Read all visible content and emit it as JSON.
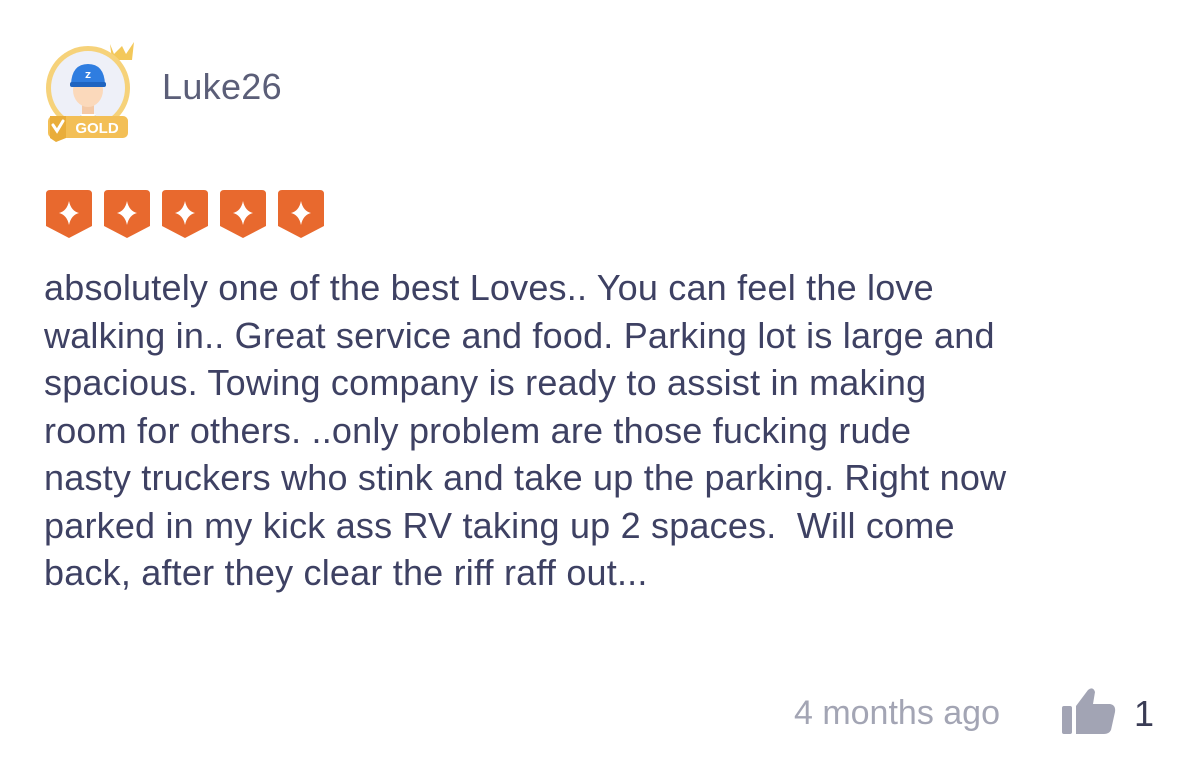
{
  "review": {
    "username": "Luke26",
    "badge": "GOLD",
    "rating": 5,
    "body": "absolutely one of the best Loves.. You can feel the love\nwalking in.. Great service and food. Parking lot is large and\nspacious. Towing company is ready to assist in making\nroom for others. ..only problem are those fucking rude\nnasty truckers who stink and take up the parking. Right now\nparked in my kick ass RV taking up 2 spaces.  Will come\nback, after they clear the riff raff out...",
    "timestamp": "4 months ago",
    "likes": "1"
  },
  "icons": {
    "avatar": "avatar-icon",
    "crown": "crown-icon",
    "badge": "gold-badge-icon",
    "rating_star": "star-icon",
    "like": "thumbs-up-icon"
  },
  "colors": {
    "star_orange": "#e8692e",
    "badge_gold": "#f3bf56",
    "username": "#5b5e78",
    "body_text": "#3e4163",
    "muted": "#a3a5b4",
    "like_icon": "#a2a4b4"
  }
}
